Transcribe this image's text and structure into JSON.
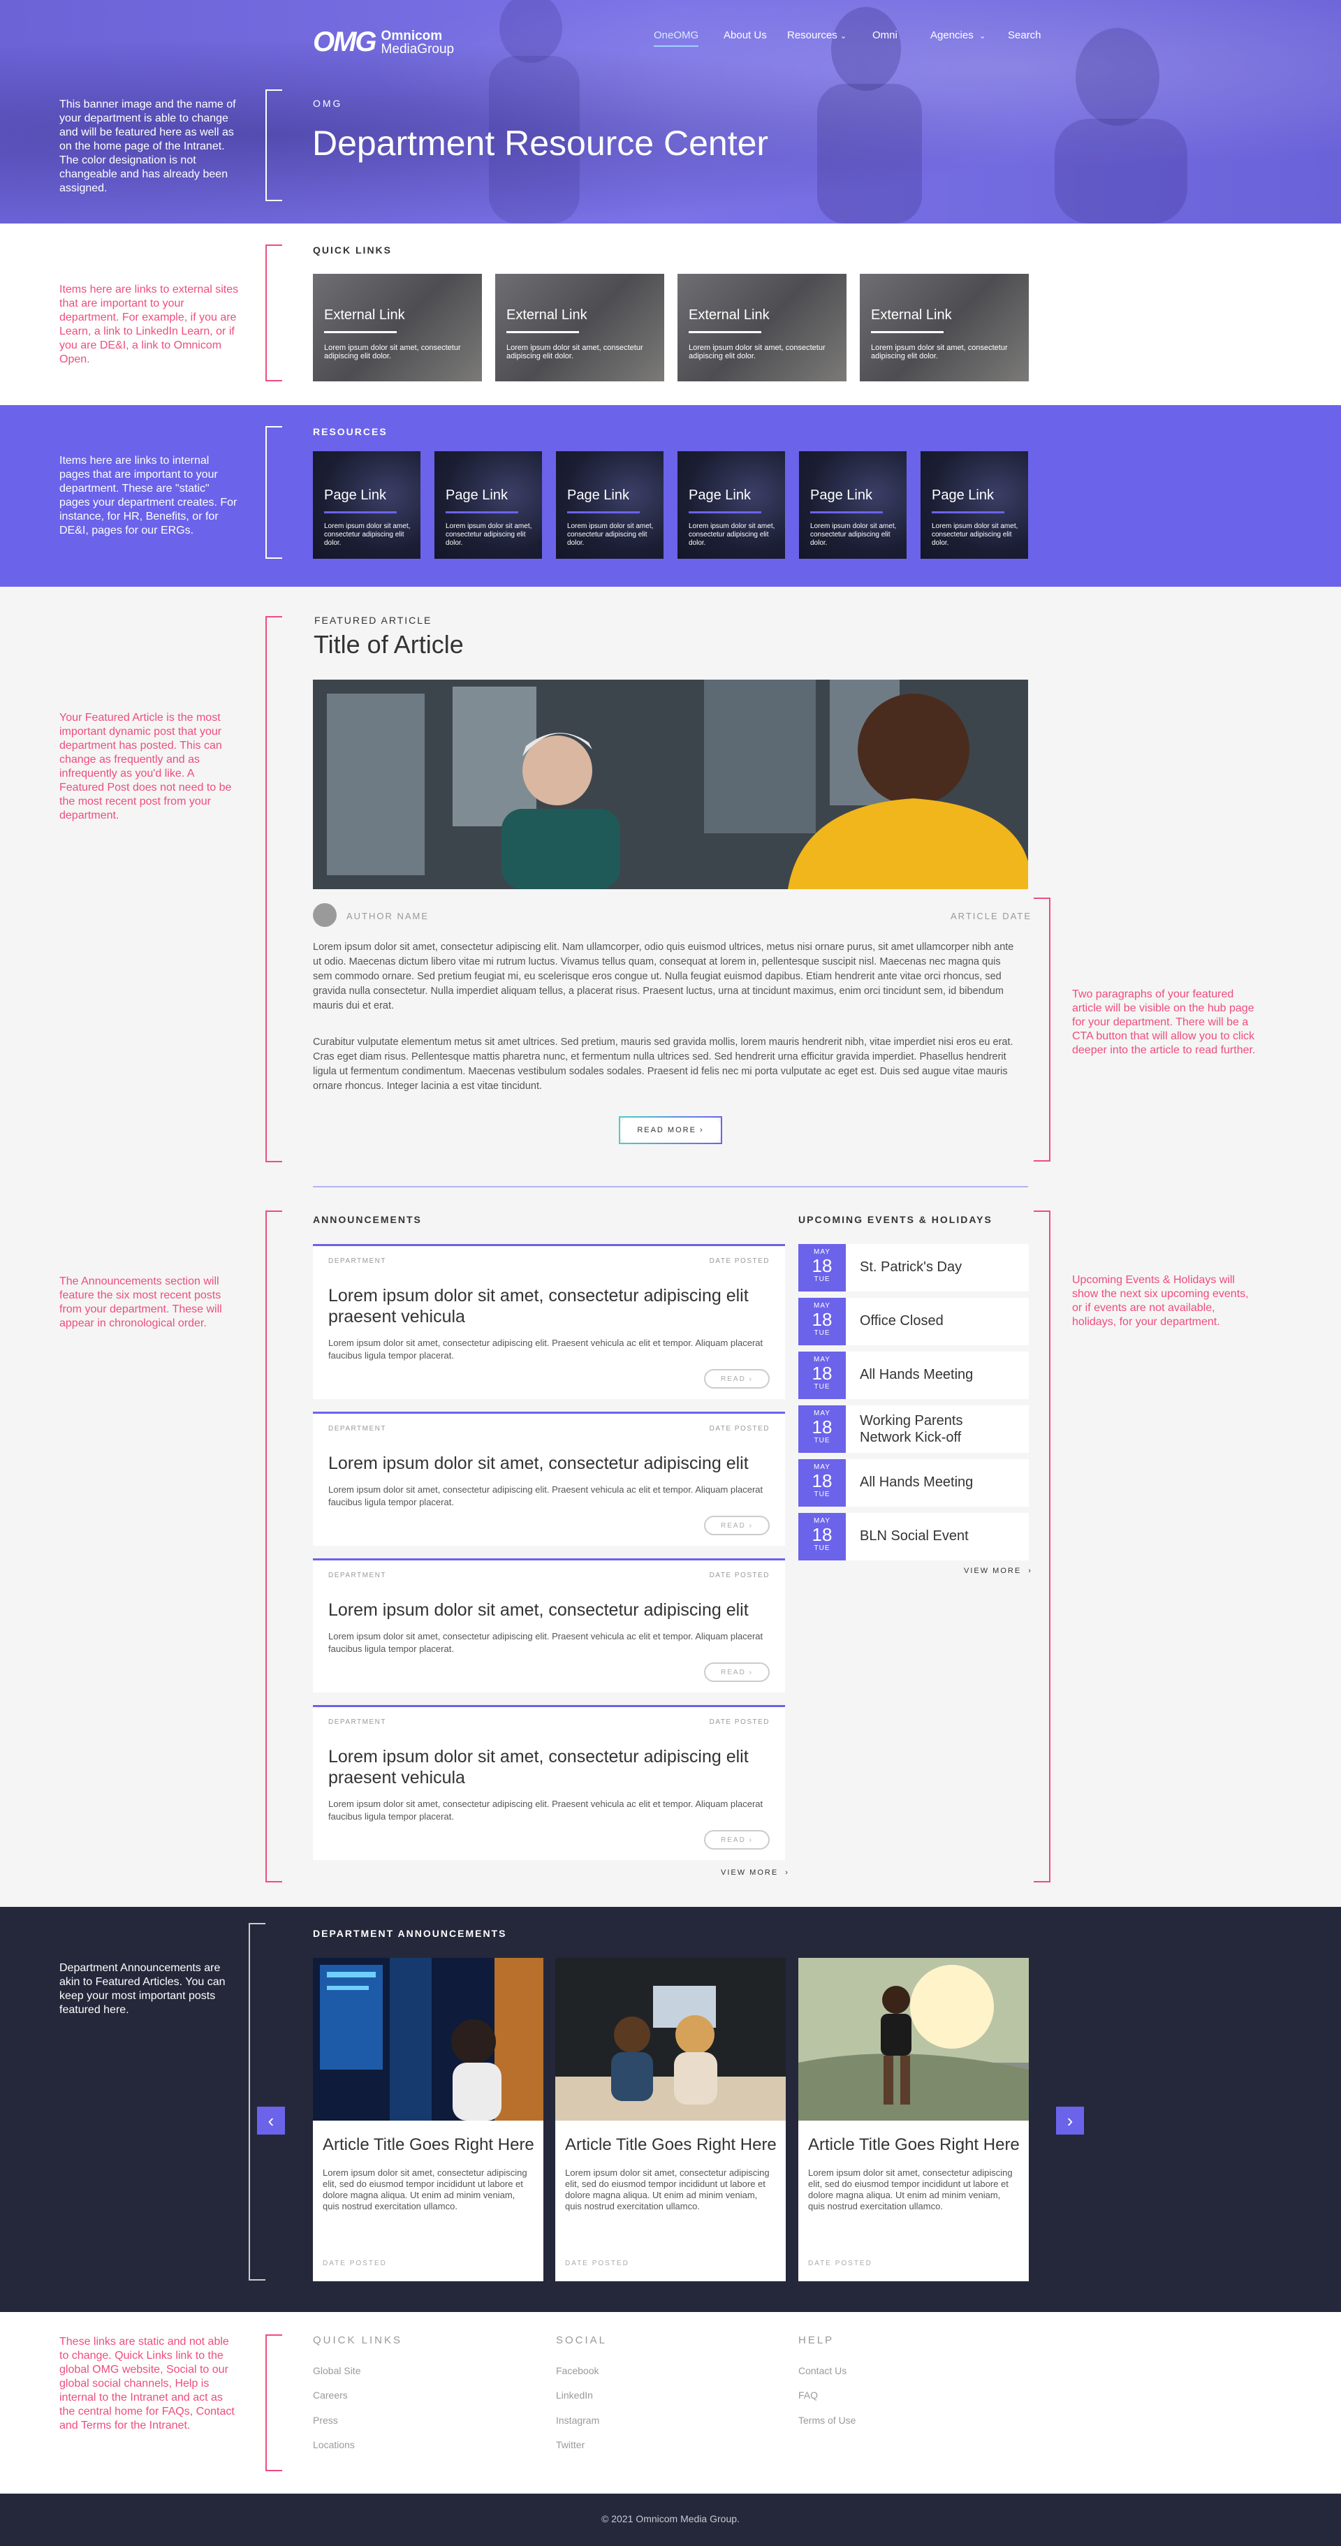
{
  "header": {
    "logo_mark": "OMG",
    "logo_line1": "Omnicom",
    "logo_line2": "MediaGroup",
    "nav": [
      "OneOMG",
      "About Us",
      "Resources",
      "Omni",
      "Agencies",
      "Search"
    ],
    "eyebrow": "OMG",
    "title": "Department Resource Center",
    "note": "This banner image and the name of your department is able to change and will be featured here as well as on the home page of the Intranet. The color designation is not changeable and has already been assigned."
  },
  "quick_links": {
    "label": "QUICK LINKS",
    "note": "Items here are links to external sites that are important to your department. For example, if you are Learn, a link to LinkedIn Learn, or if you are DE&I, a link to Omnicom Open.",
    "cards": [
      {
        "title": "External Link",
        "desc": "Lorem ipsum dolor sit amet, consectetur adipiscing elit dolor."
      },
      {
        "title": "External Link",
        "desc": "Lorem ipsum dolor sit amet, consectetur adipiscing elit dolor."
      },
      {
        "title": "External Link",
        "desc": "Lorem ipsum dolor sit amet, consectetur adipiscing elit dolor."
      },
      {
        "title": "External Link",
        "desc": "Lorem ipsum dolor sit amet, consectetur adipiscing elit dolor."
      }
    ]
  },
  "resources": {
    "label": "RESOURCES",
    "note": "Items here are links to internal pages that are important to your department. These are \"static\" pages your department creates. For instance, for HR, Benefits, or for DE&I, pages for our ERGs.",
    "cards": [
      {
        "title": "Page Link",
        "desc": "Lorem ipsum dolor sit amet, consectetur adipiscing elit dolor."
      },
      {
        "title": "Page Link",
        "desc": "Lorem ipsum dolor sit amet, consectetur adipiscing elit dolor."
      },
      {
        "title": "Page Link",
        "desc": "Lorem ipsum dolor sit amet, consectetur adipiscing elit dolor."
      },
      {
        "title": "Page Link",
        "desc": "Lorem ipsum dolor sit amet, consectetur adipiscing elit dolor."
      },
      {
        "title": "Page Link",
        "desc": "Lorem ipsum dolor sit amet, consectetur adipiscing elit dolor."
      },
      {
        "title": "Page Link",
        "desc": "Lorem ipsum dolor sit amet, consectetur adipiscing elit dolor."
      }
    ]
  },
  "featured": {
    "label": "FEATURED ARTICLE",
    "title": "Title of Article",
    "author": "AUTHOR NAME",
    "date": "ARTICLE DATE",
    "note_left": "Your Featured Article is the most important dynamic post that your department has posted. This can change as frequently and as infrequently as you'd like. A Featured Post does not need to be the most recent post from your department.",
    "note_right": "Two paragraphs of your featured article will be visible on the hub page for your department. There will be a CTA button that will allow you to click deeper into the article to read further.",
    "para1": "Lorem ipsum dolor sit amet, consectetur adipiscing elit. Nam ullamcorper, odio quis euismod ultrices, metus nisi ornare purus, sit amet ullamcorper nibh ante ut odio. Maecenas dictum libero vitae mi rutrum luctus. Vivamus tellus quam, consequat at lorem in, pellentesque suscipit nisl. Maecenas nec magna quis sem commodo ornare. Sed pretium feugiat mi, eu scelerisque eros congue ut. Nulla feugiat euismod dapibus. Etiam hendrerit ante vitae orci rhoncus, sed gravida nulla consectetur. Nulla imperdiet aliquam tellus, a placerat risus. Praesent luctus, urna at tincidunt maximus, enim orci tincidunt sem, id bibendum mauris dui et erat.",
    "para2": "Curabitur vulputate elementum metus sit amet ultrices. Sed pretium, mauris sed gravida mollis, lorem mauris hendrerit nibh, vitae imperdiet nisi eros eu erat. Cras eget diam risus. Pellentesque mattis pharetra nunc, et fermentum nulla ultrices sed. Sed hendrerit urna efficitur gravida imperdiet. Phasellus hendrerit ligula ut fermentum condimentum. Maecenas vestibulum sodales sodales. Praesent id felis nec mi porta vulputate ac eget est. Duis sed augue vitae mauris ornare rhoncus. Integer lacinia a est vitae tincidunt.",
    "cta": "READ MORE"
  },
  "announcements": {
    "label": "ANNOUNCEMENTS",
    "note": "The Announcements section will feature the six most recent posts from your department. These will appear in chronological order.",
    "items": [
      {
        "dept": "DEPARTMENT",
        "date": "DATE POSTED",
        "title": "Lorem ipsum dolor sit amet, consectetur adipiscing elit praesent vehicula",
        "body": "Lorem ipsum dolor sit amet, consectetur adipiscing elit. Praesent vehicula ac elit et tempor. Aliquam placerat faucibus ligula tempor placerat.",
        "cta": "READ"
      },
      {
        "dept": "DEPARTMENT",
        "date": "DATE POSTED",
        "title": "Lorem ipsum dolor sit amet, consectetur adipiscing elit",
        "body": "Lorem ipsum dolor sit amet, consectetur adipiscing elit. Praesent vehicula ac elit et tempor. Aliquam placerat faucibus ligula tempor placerat.",
        "cta": "READ"
      },
      {
        "dept": "DEPARTMENT",
        "date": "DATE POSTED",
        "title": "Lorem ipsum dolor sit amet, consectetur adipiscing elit",
        "body": "Lorem ipsum dolor sit amet, consectetur adipiscing elit. Praesent vehicula ac elit et tempor. Aliquam placerat faucibus ligula tempor placerat.",
        "cta": "READ"
      },
      {
        "dept": "DEPARTMENT",
        "date": "DATE POSTED",
        "title": "Lorem ipsum dolor sit amet, consectetur adipiscing elit praesent vehicula",
        "body": "Lorem ipsum dolor sit amet, consectetur adipiscing elit. Praesent vehicula ac elit et tempor. Aliquam placerat faucibus ligula tempor placerat.",
        "cta": "READ"
      }
    ],
    "view_more": "VIEW MORE"
  },
  "events": {
    "label": "UPCOMING EVENTS & HOLIDAYS",
    "note": "Upcoming Events & Holidays will show the next six upcoming events, or if events are not available, holidays, for your department.",
    "items": [
      {
        "month": "MAY",
        "day": "18",
        "weekday": "TUE",
        "name": "St. Patrick's Day"
      },
      {
        "month": "MAY",
        "day": "18",
        "weekday": "TUE",
        "name": "Office Closed"
      },
      {
        "month": "MAY",
        "day": "18",
        "weekday": "TUE",
        "name": "All Hands Meeting"
      },
      {
        "month": "MAY",
        "day": "18",
        "weekday": "TUE",
        "name": "Working Parents Network Kick-off"
      },
      {
        "month": "MAY",
        "day": "18",
        "weekday": "TUE",
        "name": "All Hands Meeting"
      },
      {
        "month": "MAY",
        "day": "18",
        "weekday": "TUE",
        "name": "BLN Social Event"
      }
    ],
    "view_more": "VIEW MORE"
  },
  "dept_announcements": {
    "label": "DEPARTMENT ANNOUNCEMENTS",
    "note": "Department Announcements are akin to Featured Articles. You can keep your most important posts featured here.",
    "cards": [
      {
        "title": "Article Title Goes Right Here",
        "desc": "Lorem ipsum dolor sit amet, consectetur adipiscing elit, sed do eiusmod tempor incididunt ut labore et dolore magna aliqua. Ut enim ad minim veniam, quis nostrud exercitation ullamco.",
        "date": "DATE POSTED"
      },
      {
        "title": "Article Title Goes Right Here",
        "desc": "Lorem ipsum dolor sit amet, consectetur adipiscing elit, sed do eiusmod tempor incididunt ut labore et dolore magna aliqua. Ut enim ad minim veniam, quis nostrud exercitation ullamco.",
        "date": "DATE POSTED"
      },
      {
        "title": "Article Title Goes Right Here",
        "desc": "Lorem ipsum dolor sit amet, consectetur adipiscing elit, sed do eiusmod tempor incididunt ut labore et dolore magna aliqua. Ut enim ad minim veniam, quis nostrud exercitation ullamco.",
        "date": "DATE POSTED"
      }
    ]
  },
  "footer": {
    "note": "These links are static and not able to change. Quick Links link to the global OMG website, Social to our global social channels, Help is internal to the Intranet and act as the central home for FAQs, Contact and Terms for the Intranet.",
    "cols": [
      {
        "heading": "QUICK LINKS",
        "links": [
          "Global Site",
          "Careers",
          "Press",
          "Locations"
        ]
      },
      {
        "heading": "SOCIAL",
        "links": [
          "Facebook",
          "LinkedIn",
          "Instagram",
          "Twitter"
        ]
      },
      {
        "heading": "HELP",
        "links": [
          "Contact Us",
          "FAQ",
          "Terms of Use"
        ]
      }
    ],
    "copyright": "© 2021 Omnicom Media Group."
  },
  "colors": {
    "accent": "#6b63ea",
    "annotation": "#ee4d7d",
    "dark": "#25283a"
  }
}
